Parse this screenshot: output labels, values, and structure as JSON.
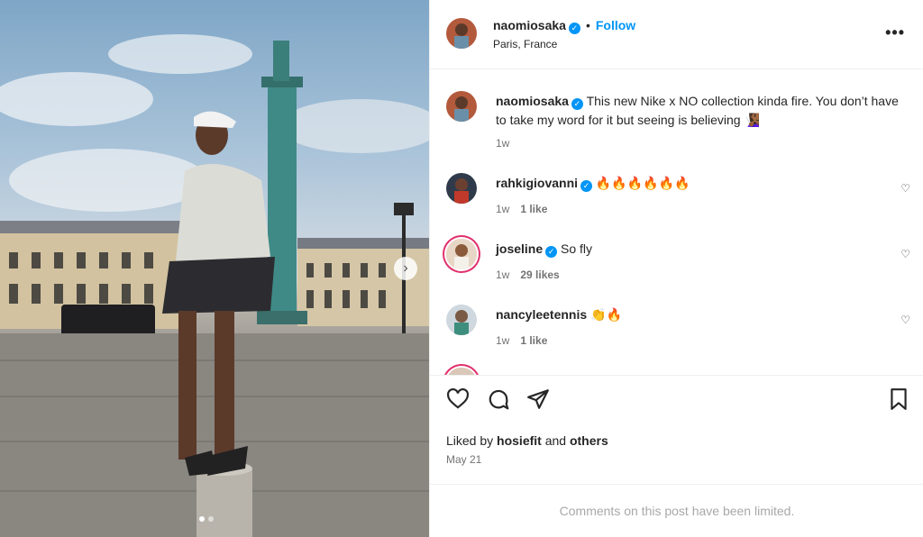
{
  "post": {
    "author": "naomiosaka",
    "follow_label": "Follow",
    "separator": "•",
    "location": "Paris, France",
    "more_label": "•••",
    "caption": "This new Nike x NO collection kinda fire. You don’t have to take my word for it but seeing is believing 🧏🏾‍♀️",
    "caption_time": "1w"
  },
  "comments": [
    {
      "user": "rahkigiovanni",
      "verified": true,
      "text": "🔥🔥🔥🔥🔥🔥",
      "time": "1w",
      "likes": "1 like"
    },
    {
      "user": "joseline",
      "verified": true,
      "text": "So fly",
      "time": "1w",
      "likes": "29 likes"
    },
    {
      "user": "nancyleetennis",
      "verified": false,
      "text": "👏🔥",
      "time": "1w",
      "likes": "1 like"
    }
  ],
  "footer": {
    "liked_prefix": "Liked by ",
    "liked_user": "hosiefit",
    "liked_and": " and ",
    "liked_others": "others",
    "date": "May 21",
    "comments_limited": "Comments on this post have been limited."
  },
  "icons": {
    "verified": "✓",
    "next": "›",
    "heart": "♡",
    "comment": "◯",
    "share": "➤",
    "save": "⛉"
  },
  "colors": {
    "accent": "#0095f6",
    "muted": "#737373",
    "limited": "#a8a8a8"
  }
}
